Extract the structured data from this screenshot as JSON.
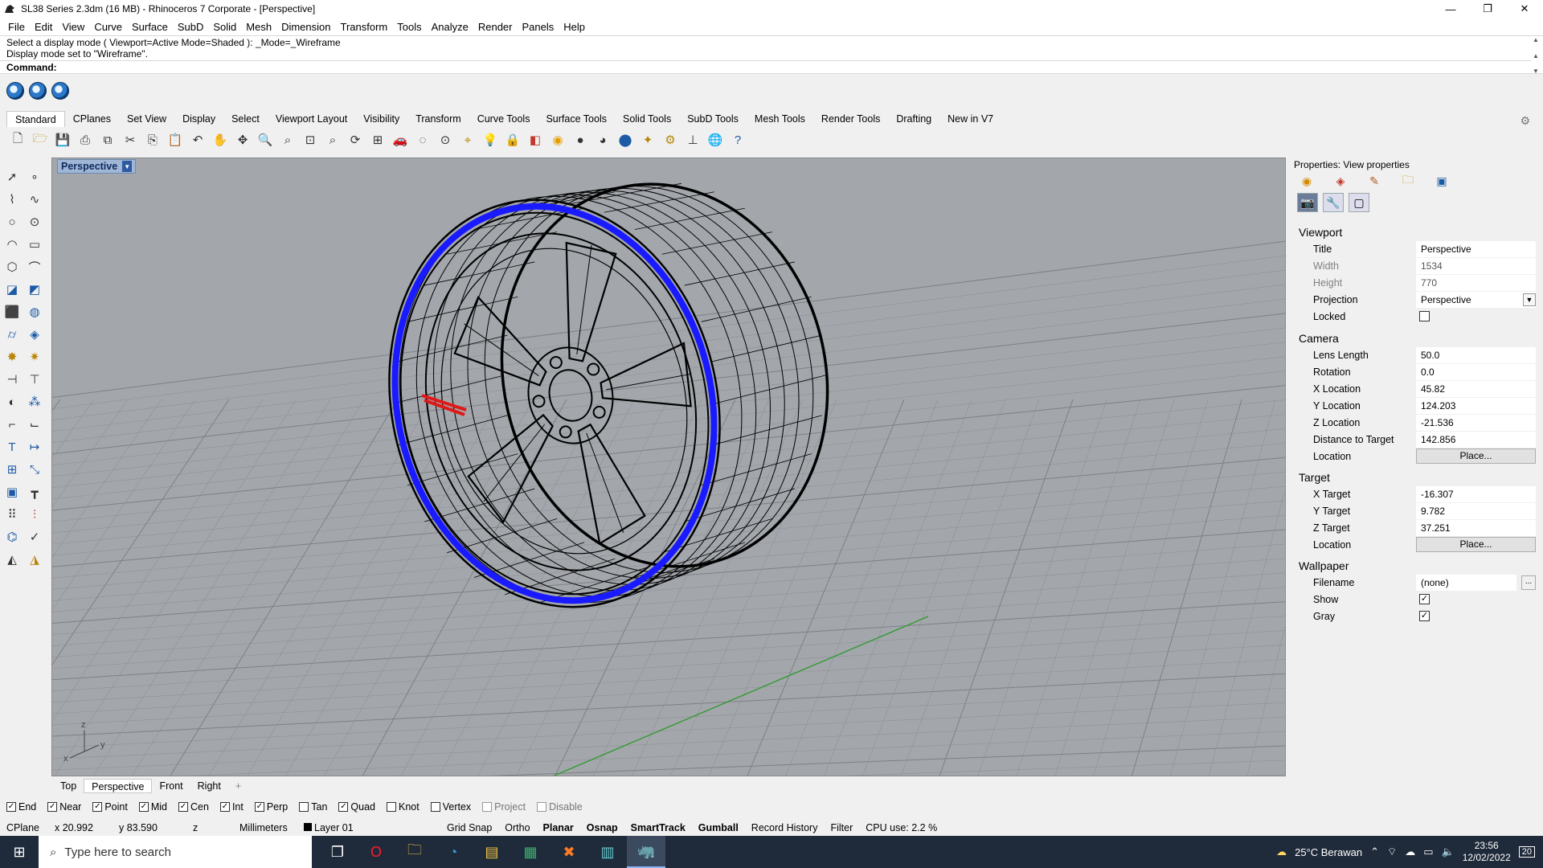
{
  "window": {
    "title": "SL38 Series 2.3dm (16 MB) - Rhinoceros 7 Corporate - [Perspective]",
    "minimize": "—",
    "maximize": "❐",
    "close": "✕"
  },
  "menu": [
    "File",
    "Edit",
    "View",
    "Curve",
    "Surface",
    "SubD",
    "Solid",
    "Mesh",
    "Dimension",
    "Transform",
    "Tools",
    "Analyze",
    "Render",
    "Panels",
    "Help"
  ],
  "command": {
    "history1": "Select a display mode ( Viewport=Active  Mode=Shaded ): _Mode=_Wireframe",
    "history2": "Display mode set to \"Wireframe\".",
    "prompt": "Command:"
  },
  "toolbar_tabs": [
    "Standard",
    "CPlanes",
    "Set View",
    "Display",
    "Select",
    "Viewport Layout",
    "Visibility",
    "Transform",
    "Curve Tools",
    "Surface Tools",
    "Solid Tools",
    "SubD Tools",
    "Mesh Tools",
    "Render Tools",
    "Drafting",
    "New in V7"
  ],
  "viewport": {
    "title": "Perspective",
    "dropdown": "▼",
    "axis_x": "x",
    "axis_y": "y",
    "axis_z": "z"
  },
  "viewport_tabs": [
    "Top",
    "Perspective",
    "Front",
    "Right",
    "+"
  ],
  "properties": {
    "header": "Properties: View properties",
    "sections": {
      "viewport": "Viewport",
      "camera": "Camera",
      "target": "Target",
      "wallpaper": "Wallpaper"
    },
    "viewport_rows": [
      {
        "label": "Title",
        "value": "Perspective"
      },
      {
        "label": "Width",
        "value": "1534"
      },
      {
        "label": "Height",
        "value": "770"
      },
      {
        "label": "Projection",
        "value": "Perspective"
      },
      {
        "label": "Locked",
        "value": ""
      }
    ],
    "camera_rows": [
      {
        "label": "Lens Length",
        "value": "50.0"
      },
      {
        "label": "Rotation",
        "value": "0.0"
      },
      {
        "label": "X Location",
        "value": "45.82"
      },
      {
        "label": "Y Location",
        "value": "124.203"
      },
      {
        "label": "Z Location",
        "value": "-21.536"
      },
      {
        "label": "Distance to Target",
        "value": "142.856"
      },
      {
        "label": "Location",
        "value": "Place..."
      }
    ],
    "target_rows": [
      {
        "label": "X Target",
        "value": "-16.307"
      },
      {
        "label": "Y Target",
        "value": "9.782"
      },
      {
        "label": "Z Target",
        "value": "37.251"
      },
      {
        "label": "Location",
        "value": "Place..."
      }
    ],
    "wallpaper_rows": [
      {
        "label": "Filename",
        "value": "(none)"
      },
      {
        "label": "Show",
        "value": "✓"
      },
      {
        "label": "Gray",
        "value": "✓"
      }
    ],
    "dots": "..."
  },
  "osnaps": [
    {
      "label": "End",
      "checked": "✓"
    },
    {
      "label": "Near",
      "checked": "✓"
    },
    {
      "label": "Point",
      "checked": "✓"
    },
    {
      "label": "Mid",
      "checked": "✓"
    },
    {
      "label": "Cen",
      "checked": "✓"
    },
    {
      "label": "Int",
      "checked": "✓"
    },
    {
      "label": "Perp",
      "checked": "✓"
    },
    {
      "label": "Tan",
      "checked": ""
    },
    {
      "label": "Quad",
      "checked": "✓"
    },
    {
      "label": "Knot",
      "checked": ""
    },
    {
      "label": "Vertex",
      "checked": ""
    },
    {
      "label": "Project",
      "checked": ""
    },
    {
      "label": "Disable",
      "checked": ""
    }
  ],
  "status": {
    "cplane": "CPlane",
    "x": "x 20.992",
    "y": "y 83.590",
    "z": "z",
    "units": "Millimeters",
    "layer": "Layer 01",
    "grid_snap": "Grid Snap",
    "ortho": "Ortho",
    "planar": "Planar",
    "osnap": "Osnap",
    "smarttrack": "SmartTrack",
    "gumball": "Gumball",
    "record_history": "Record History",
    "filter": "Filter",
    "cpu": "CPU use: 2.2 %"
  },
  "taskbar": {
    "search_placeholder": "Type here to search",
    "weather": "25°C  Berawan",
    "time": "23:56",
    "date": "12/02/2022",
    "notif": "20"
  },
  "colors": {
    "viewport_bg": "#a3a7ac",
    "rim_blue": "#1a1aff",
    "green_axis": "#3a9a3a",
    "red_caliper": "#e01818"
  }
}
